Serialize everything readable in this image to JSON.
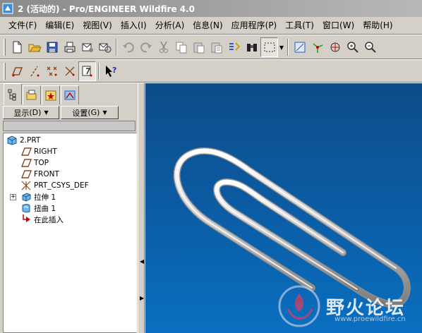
{
  "window": {
    "title": "2 (活动的) - Pro/ENGINEER Wildfire 4.0"
  },
  "menu": [
    {
      "label": "文件(F)"
    },
    {
      "label": "编辑(E)"
    },
    {
      "label": "视图(V)"
    },
    {
      "label": "插入(I)"
    },
    {
      "label": "分析(A)"
    },
    {
      "label": "信息(N)"
    },
    {
      "label": "应用程序(P)"
    },
    {
      "label": "工具(T)"
    },
    {
      "label": "窗口(W)"
    },
    {
      "label": "帮助(H)"
    }
  ],
  "navigator": {
    "show_button": "显示",
    "show_key": "(D)",
    "settings_button": "设置",
    "settings_key": "(G)"
  },
  "model_tree": {
    "items": [
      {
        "label": "2.PRT",
        "icon": "part-icon"
      },
      {
        "label": "RIGHT",
        "icon": "datum-plane-icon"
      },
      {
        "label": "TOP",
        "icon": "datum-plane-icon"
      },
      {
        "label": "FRONT",
        "icon": "datum-plane-icon"
      },
      {
        "label": "PRT_CSYS_DEF",
        "icon": "csys-icon"
      },
      {
        "label": "拉伸 1",
        "icon": "extrude-icon",
        "expandable": true
      },
      {
        "label": "扭曲 1",
        "icon": "warp-icon"
      },
      {
        "label": "在此插入",
        "icon": "insert-here-arrow-icon"
      }
    ]
  },
  "viewport": {
    "watermark_title": "野火论坛",
    "watermark_url": "www.proewildfire.cn"
  },
  "colors": {
    "accent_red": "#cc0000",
    "viewport_blue": "#0b5aa1"
  }
}
